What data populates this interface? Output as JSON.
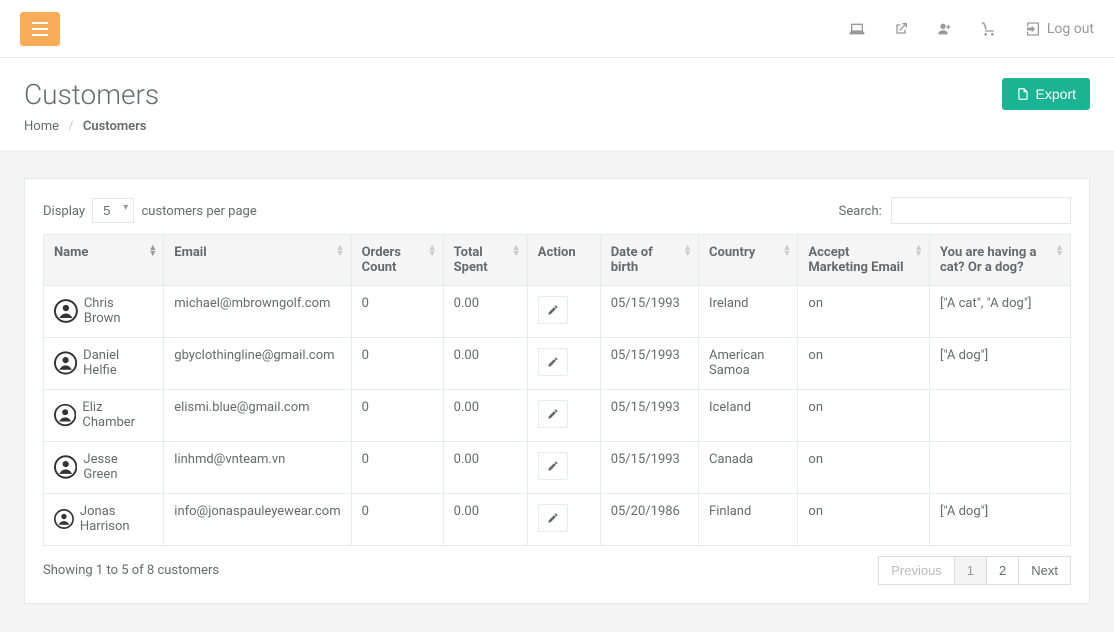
{
  "topbar": {
    "logout_label": "Log out"
  },
  "header": {
    "title": "Customers",
    "breadcrumb_home": "Home",
    "breadcrumb_current": "Customers",
    "export_label": "Export"
  },
  "controls": {
    "display_prefix": "Display",
    "display_value": "5",
    "display_suffix": "customers per page",
    "search_label": "Search:",
    "search_value": ""
  },
  "columns": {
    "name": "Name",
    "email": "Email",
    "orders": "Orders Count",
    "spent": "Total Spent",
    "action": "Action",
    "dob": "Date of birth",
    "country": "Country",
    "marketing": "Accept Marketing Email",
    "pet": "You are having a cat? Or a dog?"
  },
  "rows": [
    {
      "name": "Chris Brown",
      "email": "michael@mbrowngolf.com",
      "orders": "0",
      "spent": "0.00",
      "dob": "05/15/1993",
      "country": "Ireland",
      "marketing": "on",
      "pet": "[\"A cat\", \"A dog\"]"
    },
    {
      "name": "Daniel Helfie",
      "email": "gbyclothingline@gmail.com",
      "orders": "0",
      "spent": "0.00",
      "dob": "05/15/1993",
      "country": "American Samoa",
      "marketing": "on",
      "pet": "[\"A dog\"]"
    },
    {
      "name": "Eliz Chamber",
      "email": "elismi.blue@gmail.com",
      "orders": "0",
      "spent": "0.00",
      "dob": "05/15/1993",
      "country": "Iceland",
      "marketing": "on",
      "pet": ""
    },
    {
      "name": "Jesse Green",
      "email": "linhmd@vnteam.vn",
      "orders": "0",
      "spent": "0.00",
      "dob": "05/15/1993",
      "country": "Canada",
      "marketing": "on",
      "pet": ""
    },
    {
      "name": "Jonas Harrison",
      "email": "info@jonaspauleyewear.com",
      "orders": "0",
      "spent": "0.00",
      "dob": "05/20/1986",
      "country": "Finland",
      "marketing": "on",
      "pet": "[\"A dog\"]"
    }
  ],
  "footer": {
    "info": "Showing 1 to 5 of 8 customers",
    "prev": "Previous",
    "page1": "1",
    "page2": "2",
    "next": "Next"
  }
}
